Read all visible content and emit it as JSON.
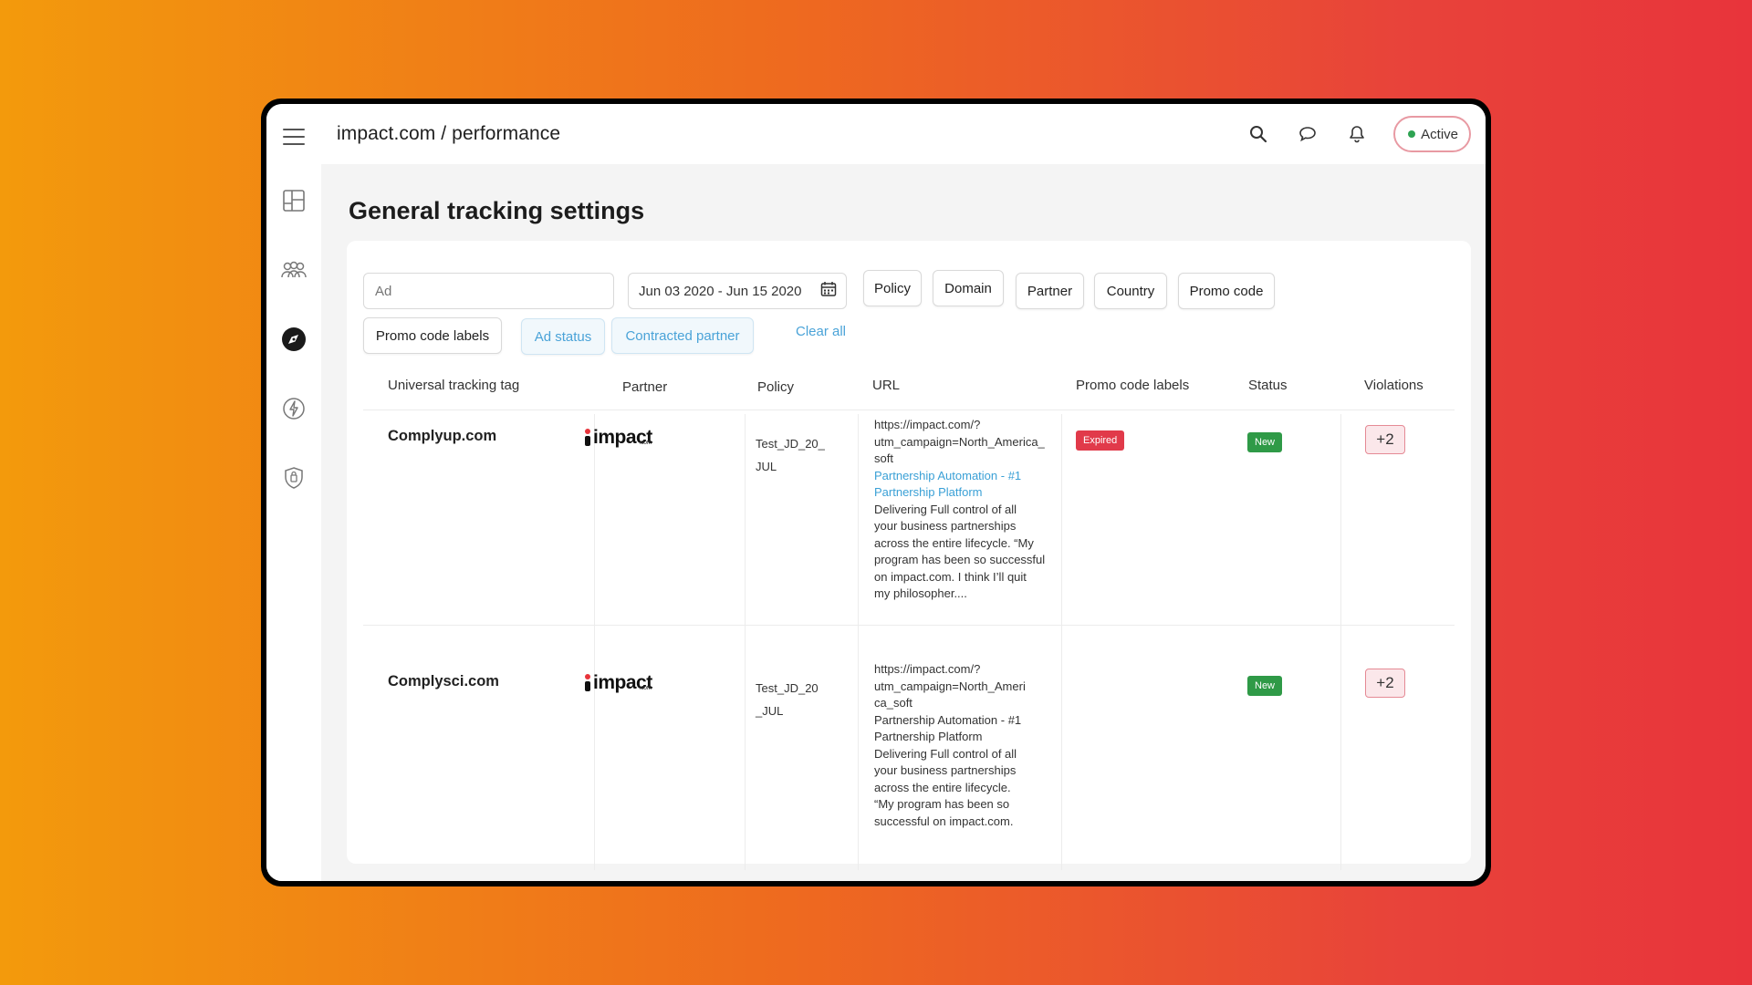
{
  "breadcrumb": "impact.com / performance",
  "status_pill": "Active",
  "page_title": "General tracking settings",
  "filters": {
    "ad_placeholder": "Ad",
    "date_range": "Jun 03 2020 - Jun 15 2020",
    "buttons": [
      "Policy",
      "Domain",
      "Partner",
      "Country",
      "Promo code",
      "Promo code labels"
    ],
    "active_buttons": [
      "Ad status",
      "Contracted partner"
    ],
    "clear_all": "Clear all"
  },
  "table": {
    "headers": [
      "Universal tracking tag",
      "Partner",
      "Policy",
      "URL",
      "Promo code labels",
      "Status",
      "Violations"
    ],
    "rows": [
      {
        "tag": "Complyup.com",
        "partner_logo": "impact",
        "partner_logo_sub": ".com",
        "policy_lines": [
          "Test_JD_20_",
          "JUL"
        ],
        "url_lines": [
          "https://impact.com/?",
          "utm_campaign=North_America_",
          "soft"
        ],
        "url_link_lines": [
          "Partnership Automation - #1",
          "Partnership Platform"
        ],
        "url_desc_lines": [
          "Delivering Full control of all",
          "your business partnerships",
          "across the entire lifecycle. “My",
          "program has been so successful",
          "on impact.com. I think I’ll quit",
          "my philosopher...."
        ],
        "promo_label": "Expired",
        "status": "New",
        "violations": "+2"
      },
      {
        "tag": "Complysci.com",
        "partner_logo": "impact",
        "partner_logo_sub": ".com",
        "policy_lines": [
          "Test_JD_20",
          "_JUL"
        ],
        "url_lines": [
          "https://impact.com/?",
          "utm_campaign=North_Ameri",
          "ca_soft",
          "Partnership Automation - #1",
          "Partnership Platform",
          "Delivering Full control of all",
          "your business partnerships",
          "across the entire lifecycle.",
          "“My program has been so",
          "successful on impact.com."
        ],
        "promo_label": "",
        "status": "New",
        "violations": "+2"
      }
    ]
  },
  "icons": {
    "sidebar": [
      "menu-icon",
      "dashboard-icon",
      "users-icon",
      "compass-icon",
      "bolt-icon",
      "shield-icon"
    ],
    "topbar": [
      "search-icon",
      "chat-icon",
      "bell-icon"
    ]
  },
  "colors": {
    "accent_blue": "#4aa3d8",
    "expired_red": "#e13a4a",
    "new_green": "#2f9a47",
    "pill_border": "#e89aa3"
  }
}
